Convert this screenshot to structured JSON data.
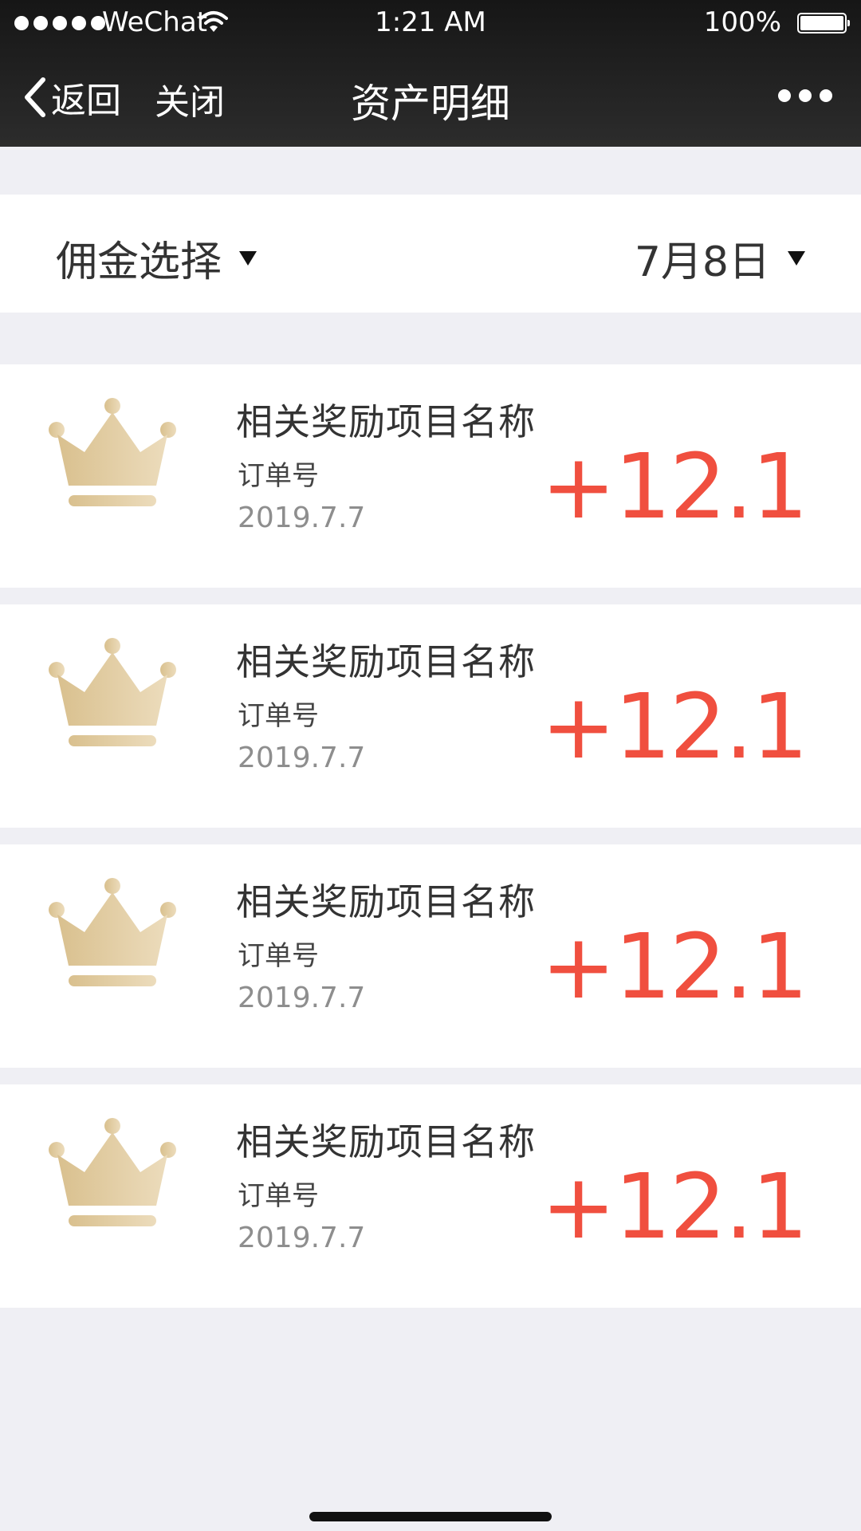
{
  "status_bar": {
    "carrier": "WeChat",
    "time": "1:21 AM",
    "battery": "100%",
    "signal_icon": "signal-dots-icon",
    "wifi_icon": "wifi-icon",
    "battery_icon": "battery-icon"
  },
  "nav": {
    "back_label": "返回",
    "close_label": "关闭",
    "title": "资产明细",
    "back_icon": "chevron-left-icon",
    "more_icon": "more-dots-icon"
  },
  "filter": {
    "left_label": "佣金选择",
    "right_label": "7月8日",
    "caret_icon": "caret-down-icon"
  },
  "records": [
    {
      "title": "相关奖励项目名称",
      "order_label": "订单号",
      "date": "2019.7.7",
      "amount": "+12.1",
      "icon": "crown-icon"
    },
    {
      "title": "相关奖励项目名称",
      "order_label": "订单号",
      "date": "2019.7.7",
      "amount": "+12.1",
      "icon": "crown-icon"
    },
    {
      "title": "相关奖励项目名称",
      "order_label": "订单号",
      "date": "2019.7.7",
      "amount": "+12.1",
      "icon": "crown-icon"
    },
    {
      "title": "相关奖励项目名称",
      "order_label": "订单号",
      "date": "2019.7.7",
      "amount": "+12.1",
      "icon": "crown-icon"
    }
  ],
  "colors": {
    "nav_background": "#1f1f1f",
    "page_background": "#efeff4",
    "amount": "#f04f3f",
    "crown_gold": "#dcc597"
  }
}
